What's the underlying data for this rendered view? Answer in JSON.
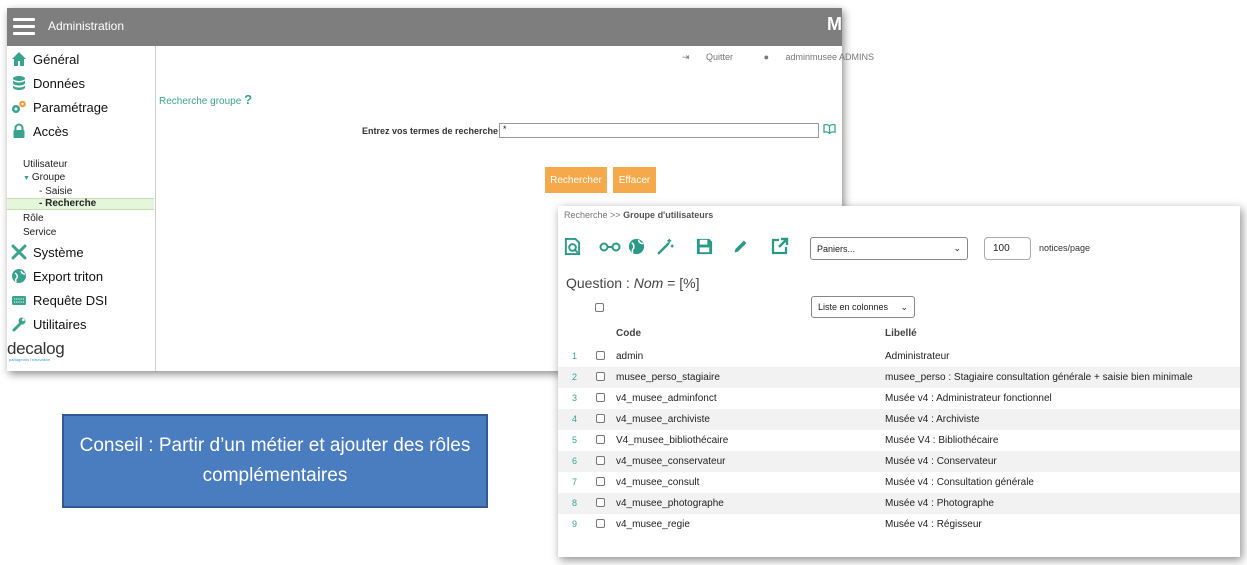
{
  "header": {
    "title": "Administration",
    "brand": "M"
  },
  "colors": {
    "topbar": "#7e7e7e",
    "accent_green": "#3aa38e",
    "button_orange": "#f6a94a",
    "tip_blue": "#4a7cc0"
  },
  "sidebar": {
    "items": [
      {
        "label": "Général",
        "icon": "home-icon"
      },
      {
        "label": "Données",
        "icon": "database-icon"
      },
      {
        "label": "Paramétrage",
        "icon": "gears-icon"
      },
      {
        "label": "Accès",
        "icon": "lock-icon"
      }
    ],
    "sub": {
      "utilisateur": "Utilisateur",
      "groupe": "Groupe",
      "saisie": "- Saisie",
      "recherche": "- Recherche",
      "role": "Rôle",
      "service": "Service"
    },
    "items2": [
      {
        "label": "Système",
        "icon": "tools-icon"
      },
      {
        "label": "Export triton",
        "icon": "globe-icon"
      },
      {
        "label": "Requête DSI",
        "icon": "keyboard-icon"
      },
      {
        "label": "Utilitaires",
        "icon": "wrench-icon"
      }
    ],
    "logo": "decalog",
    "logo_sub": "partageons l'innovation"
  },
  "main": {
    "quit": "Quitter",
    "user": "adminmusee ADMINS",
    "search_title": "Recherche groupe",
    "help": "?",
    "search_label": "Entrez vos termes de recherche",
    "search_value": "*",
    "btn_search": "Rechercher",
    "btn_clear": "Effacer"
  },
  "results": {
    "breadcrumb": "Recherche >>",
    "breadcrumb_current": "Groupe d'utilisateurs",
    "paniers": "Paniers...",
    "per_page_value": "100",
    "per_page_label": "notices/page",
    "question_prefix": "Question :",
    "question_field": "Nom",
    "question_rest": "= [%]",
    "view_mode": "Liste en colonnes",
    "col_code": "Code",
    "col_libelle": "Libellé",
    "rows": [
      {
        "n": "1",
        "code": "admin",
        "libelle": "Administrateur"
      },
      {
        "n": "2",
        "code": "musee_perso_stagiaire",
        "libelle": "musee_perso : Stagiaire consultation générale + saisie bien minimale"
      },
      {
        "n": "3",
        "code": "v4_musee_adminfonct",
        "libelle": "Musée v4 : Administrateur fonctionnel"
      },
      {
        "n": "4",
        "code": "v4_musee_archiviste",
        "libelle": "Musée v4 : Archiviste"
      },
      {
        "n": "5",
        "code": "V4_musee_bibliothécaire",
        "libelle": "Musée V4 : Bibliothécaire"
      },
      {
        "n": "6",
        "code": "v4_musee_conservateur",
        "libelle": "Musée v4 : Conservateur"
      },
      {
        "n": "7",
        "code": "v4_musee_consult",
        "libelle": "Musée v4 : Consultation générale"
      },
      {
        "n": "8",
        "code": "v4_musee_photographe",
        "libelle": "Musée v4 : Photographe"
      },
      {
        "n": "9",
        "code": "v4_musee_regie",
        "libelle": "Musée v4 : Régisseur"
      }
    ]
  },
  "tip": "Conseil : Partir d’un métier et ajouter des rôles complémentaires"
}
